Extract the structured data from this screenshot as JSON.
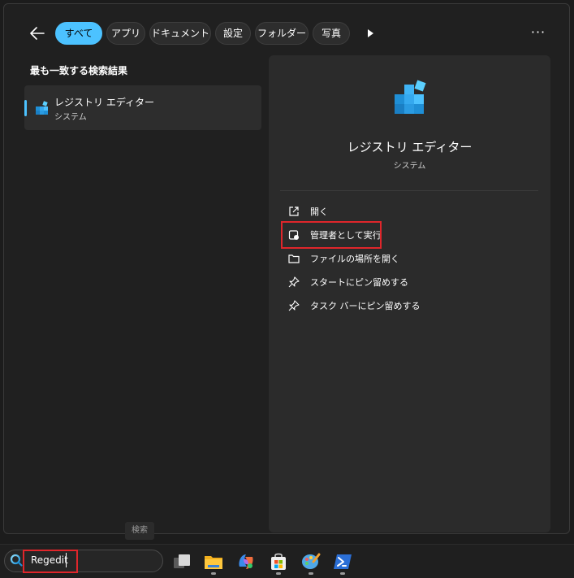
{
  "filters": [
    "すべて",
    "アプリ",
    "ドキュメント",
    "設定",
    "フォルダー",
    "写真"
  ],
  "active_filter": 0,
  "best_match_title": "最も一致する検索結果",
  "result": {
    "name": "レジストリ エディター",
    "type": "システム"
  },
  "detail": {
    "name": "レジストリ エディター",
    "type": "システム",
    "actions": [
      "開く",
      "管理者として実行",
      "ファイルの場所を開く",
      "スタートにピン留めする",
      "タスク バーにピン留めする"
    ]
  },
  "more_label": "···",
  "tooltip": "検索",
  "search": {
    "value": "Regedit"
  },
  "icons": {
    "back": "arrow-left-icon",
    "play": "play-icon",
    "more": "more-icon",
    "app": "registry-editor-icon",
    "actions": [
      "open-external-icon",
      "run-as-admin-icon",
      "folder-icon",
      "pin-icon",
      "pin-icon"
    ],
    "taskbar": [
      "task-view-icon",
      "file-explorer-icon",
      "copilot-icon",
      "microsoft-store-icon",
      "paint-icon",
      "powershell-icon"
    ]
  },
  "colors": {
    "accent": "#4cc2ff",
    "highlight": "#e0262b",
    "background": "#202020"
  }
}
